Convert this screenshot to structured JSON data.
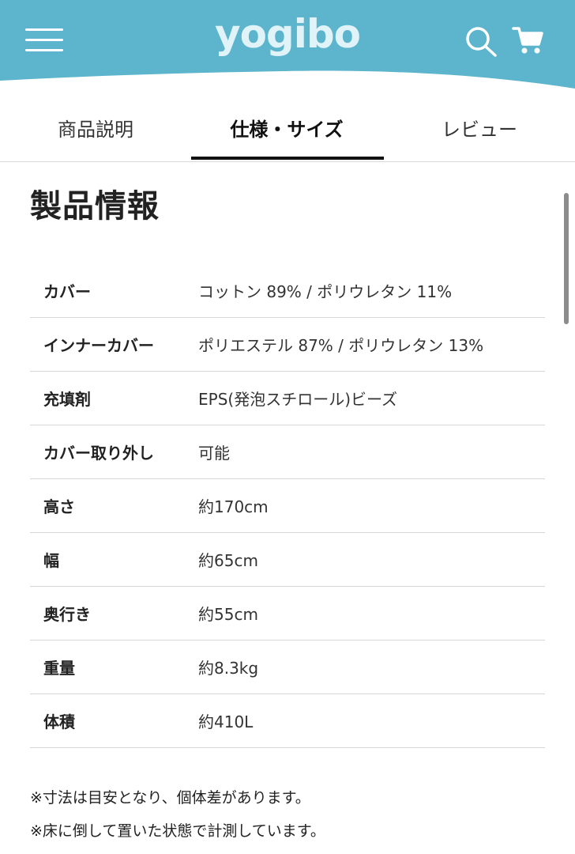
{
  "header": {
    "logo": "yogibo",
    "brand_color": "#5cb5cc",
    "icons": [
      "hamburger-menu-icon",
      "search-icon",
      "cart-icon"
    ]
  },
  "tabs": [
    {
      "label": "商品説明",
      "active": false
    },
    {
      "label": "仕様・サイズ",
      "active": true
    },
    {
      "label": "レビュー",
      "active": false
    }
  ],
  "section": {
    "title": "製品情報"
  },
  "specs": [
    {
      "label": "カバー",
      "value": "コットン 89% / ポリウレタン 11%"
    },
    {
      "label": "インナーカバー",
      "value": "ポリエステル 87% / ポリウレタン 13%"
    },
    {
      "label": "充填剤",
      "value": "EPS(発泡スチロール)ビーズ"
    },
    {
      "label": "カバー取り外し",
      "value": "可能"
    },
    {
      "label": "高さ",
      "value": "約170cm"
    },
    {
      "label": "幅",
      "value": "約65cm"
    },
    {
      "label": "奥行き",
      "value": "約55cm"
    },
    {
      "label": "重量",
      "value": "約8.3kg"
    },
    {
      "label": "体積",
      "value": "約410L"
    }
  ],
  "notes": [
    "※寸法は目安となり、個体差があります。",
    "※床に倒して置いた状態で計測しています。"
  ]
}
